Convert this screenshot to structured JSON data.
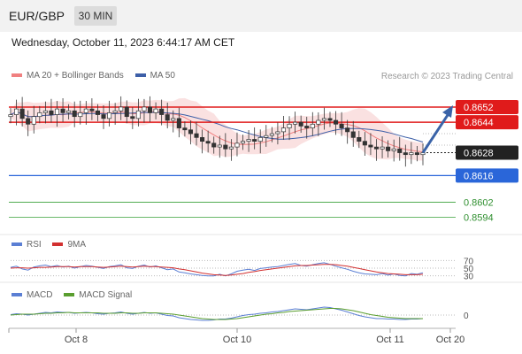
{
  "header": {
    "symbol": "EUR/GBP",
    "interval": "30 MIN",
    "datetime": "Wednesday, October 11, 2023 6:44:17 AM CET"
  },
  "legend": {
    "ma20_label": "MA 20 + Bollinger Bands",
    "ma50_label": "MA 50",
    "credit": "Research © 2023 Trading Central",
    "rsi_label": "RSI",
    "rsi_ma_label": "9MA",
    "macd_label": "MACD",
    "macd_signal_label": "MACD Signal"
  },
  "colors": {
    "resistance": "#e01b1b",
    "support": "#2a66d9",
    "target": "#3aa13a",
    "current": "#222222",
    "ma20": "#f08080",
    "ma50": "#3d5fa8",
    "rsi": "#5b7fd4",
    "rsi_ma": "#d23030",
    "macd": "#5b7fd4",
    "macd_signal": "#5a9e2f"
  },
  "chart_data": [
    {
      "type": "candlestick",
      "panel": "price",
      "x_ticks": [
        "Oct 8",
        "Oct 10",
        "Oct 11",
        "Oct 20"
      ],
      "ylim": [
        0.8585,
        0.8665
      ],
      "levels": [
        {
          "value": 0.8652,
          "label": "0.8652",
          "kind": "resistance"
        },
        {
          "value": 0.8644,
          "label": "0.8644",
          "kind": "resistance"
        },
        {
          "value": 0.8628,
          "label": "0.8628",
          "kind": "current"
        },
        {
          "value": 0.8616,
          "label": "0.8616",
          "kind": "support"
        },
        {
          "value": 0.8602,
          "label": "0.8602",
          "kind": "target"
        },
        {
          "value": 0.8594,
          "label": "0.8594",
          "kind": "target"
        }
      ],
      "close": [
        0.8648,
        0.8651,
        0.8646,
        0.8643,
        0.8647,
        0.8649,
        0.865,
        0.8648,
        0.8651,
        0.8649,
        0.865,
        0.8647,
        0.8649,
        0.8651,
        0.865,
        0.8648,
        0.8646,
        0.8649,
        0.865,
        0.8652,
        0.8647,
        0.8646,
        0.865,
        0.8652,
        0.8649,
        0.8651,
        0.8648,
        0.8645,
        0.8646,
        0.8641,
        0.864,
        0.8638,
        0.8636,
        0.8634,
        0.8633,
        0.8631,
        0.8632,
        0.863,
        0.8631,
        0.8633,
        0.8634,
        0.8635,
        0.8634,
        0.8636,
        0.8637,
        0.8638,
        0.8639,
        0.8641,
        0.8643,
        0.8644,
        0.8642,
        0.8641,
        0.8643,
        0.8645,
        0.8646,
        0.8645,
        0.8643,
        0.8641,
        0.8639,
        0.8636,
        0.8634,
        0.8632,
        0.8631,
        0.863,
        0.8631,
        0.8629,
        0.863,
        0.8628,
        0.8627,
        0.8628,
        0.8627,
        0.8628
      ],
      "forecast": {
        "from": 0.8628,
        "to": 0.8652
      }
    },
    {
      "type": "line",
      "panel": "rsi",
      "yticks": [
        70,
        50,
        30
      ],
      "series": [
        {
          "name": "RSI",
          "values": [
            52,
            55,
            48,
            45,
            53,
            56,
            58,
            54,
            57,
            53,
            55,
            50,
            54,
            57,
            55,
            52,
            49,
            54,
            56,
            59,
            51,
            49,
            55,
            58,
            53,
            56,
            51,
            46,
            48,
            40,
            38,
            35,
            33,
            31,
            30,
            30,
            34,
            30,
            35,
            42,
            45,
            47,
            44,
            49,
            51,
            53,
            54,
            57,
            60,
            62,
            57,
            55,
            59,
            62,
            64,
            60,
            55,
            51,
            47,
            42,
            38,
            35,
            34,
            33,
            36,
            32,
            35,
            31,
            30,
            36,
            34,
            38
          ]
        },
        {
          "name": "9MA",
          "values": [
            50,
            51,
            51,
            50,
            51,
            52,
            52,
            53,
            54,
            54,
            54,
            53,
            54,
            54,
            54,
            53,
            52,
            53,
            54,
            55,
            54,
            53,
            54,
            55,
            54,
            54,
            53,
            52,
            51,
            48,
            46,
            43,
            40,
            37,
            35,
            33,
            32,
            31,
            32,
            34,
            36,
            39,
            41,
            44,
            46,
            48,
            50,
            52,
            54,
            56,
            57,
            57,
            58,
            59,
            60,
            60,
            59,
            57,
            55,
            52,
            49,
            46,
            43,
            40,
            38,
            36,
            35,
            34,
            33,
            33,
            33,
            34
          ]
        }
      ]
    },
    {
      "type": "line",
      "panel": "macd",
      "yticks": [
        0
      ],
      "series": [
        {
          "name": "MACD",
          "values": [
            0.1,
            0.3,
            0.2,
            0.0,
            0.2,
            0.4,
            0.6,
            0.5,
            0.7,
            0.6,
            0.6,
            0.4,
            0.5,
            0.6,
            0.5,
            0.3,
            0.2,
            0.4,
            0.5,
            0.7,
            0.4,
            0.2,
            0.4,
            0.6,
            0.4,
            0.5,
            0.2,
            -0.1,
            -0.2,
            -0.6,
            -0.8,
            -1.0,
            -1.1,
            -1.2,
            -1.2,
            -1.1,
            -0.9,
            -0.9,
            -0.7,
            -0.4,
            -0.1,
            0.1,
            0.2,
            0.4,
            0.5,
            0.7,
            0.8,
            1.0,
            1.2,
            1.4,
            1.3,
            1.2,
            1.4,
            1.6,
            1.8,
            1.7,
            1.4,
            1.1,
            0.7,
            0.3,
            -0.1,
            -0.4,
            -0.6,
            -0.8,
            -0.8,
            -0.9,
            -0.9,
            -1.0,
            -1.0,
            -0.9,
            -0.9,
            -0.8
          ]
        },
        {
          "name": "MACD Signal",
          "values": [
            0.0,
            0.1,
            0.2,
            0.2,
            0.2,
            0.3,
            0.4,
            0.4,
            0.5,
            0.5,
            0.6,
            0.5,
            0.5,
            0.5,
            0.5,
            0.5,
            0.4,
            0.4,
            0.4,
            0.5,
            0.5,
            0.4,
            0.4,
            0.5,
            0.5,
            0.5,
            0.4,
            0.3,
            0.2,
            0.0,
            -0.2,
            -0.4,
            -0.6,
            -0.8,
            -0.9,
            -1.0,
            -1.0,
            -1.0,
            -0.9,
            -0.8,
            -0.6,
            -0.4,
            -0.2,
            0.0,
            0.2,
            0.3,
            0.5,
            0.6,
            0.8,
            0.9,
            1.0,
            1.1,
            1.2,
            1.3,
            1.4,
            1.5,
            1.5,
            1.4,
            1.2,
            1.0,
            0.7,
            0.4,
            0.1,
            -0.1,
            -0.3,
            -0.5,
            -0.6,
            -0.7,
            -0.8,
            -0.8,
            -0.8,
            -0.8
          ]
        }
      ]
    }
  ]
}
